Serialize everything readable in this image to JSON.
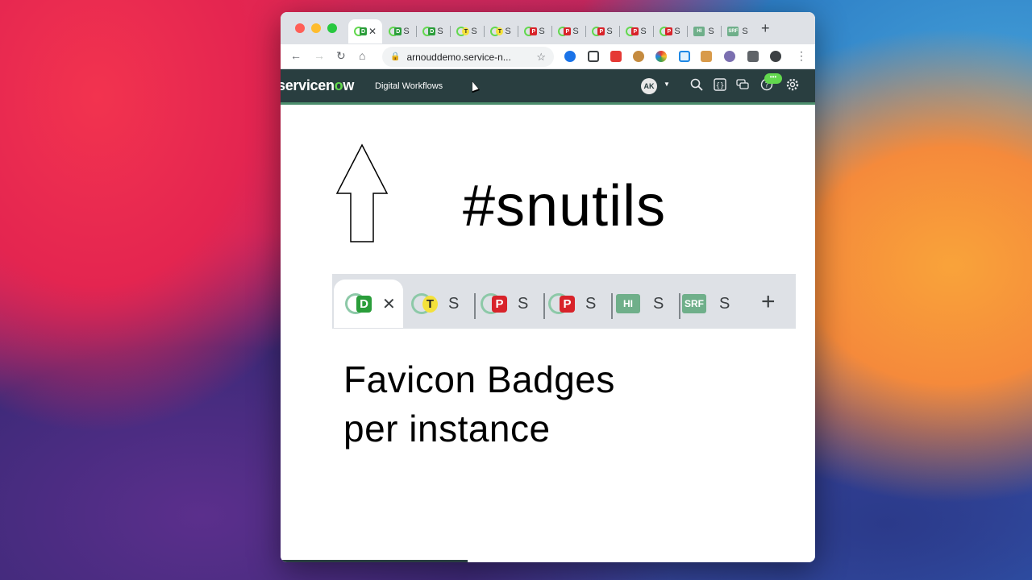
{
  "browser": {
    "tabs": [
      {
        "badge": "D",
        "kind": "ring",
        "title": "",
        "active": true,
        "close": "✕"
      },
      {
        "badge": "D",
        "kind": "ring",
        "title": "S"
      },
      {
        "badge": "D",
        "kind": "ring",
        "title": "S"
      },
      {
        "badge": "T",
        "kind": "ring",
        "title": "S"
      },
      {
        "badge": "T",
        "kind": "ring",
        "title": "S"
      },
      {
        "badge": "P",
        "kind": "ring",
        "title": "S"
      },
      {
        "badge": "P",
        "kind": "ring",
        "title": "S"
      },
      {
        "badge": "P",
        "kind": "ring",
        "title": "S"
      },
      {
        "badge": "P",
        "kind": "ring",
        "title": "S"
      },
      {
        "badge": "P",
        "kind": "ring",
        "title": "S"
      },
      {
        "badge": "HI",
        "kind": "square",
        "title": "S"
      },
      {
        "badge": "SRF",
        "kind": "square",
        "title": "S"
      }
    ],
    "new_tab": "+",
    "url": "arnouddemo.service-n..."
  },
  "servicenow": {
    "logo_main": "servicen",
    "logo_o": "o",
    "logo_end": "w",
    "subtitle": "Digital Workflows",
    "avatar": "AK",
    "chat_badge": "•••"
  },
  "slide": {
    "hashtag": "#snutils",
    "tabs": [
      {
        "badge": "D",
        "kind": "ring",
        "title": "✕",
        "active": true
      },
      {
        "badge": "T",
        "kind": "ring",
        "title": "S"
      },
      {
        "badge": "P",
        "kind": "ring",
        "title": "S"
      },
      {
        "badge": "P",
        "kind": "ring",
        "title": "S"
      },
      {
        "badge": "HI",
        "kind": "square",
        "title": "S"
      },
      {
        "badge": "SRF",
        "kind": "square",
        "title": "S"
      }
    ],
    "new_tab": "+",
    "caption_line1": "Favicon Badges",
    "caption_line2": "per instance"
  }
}
